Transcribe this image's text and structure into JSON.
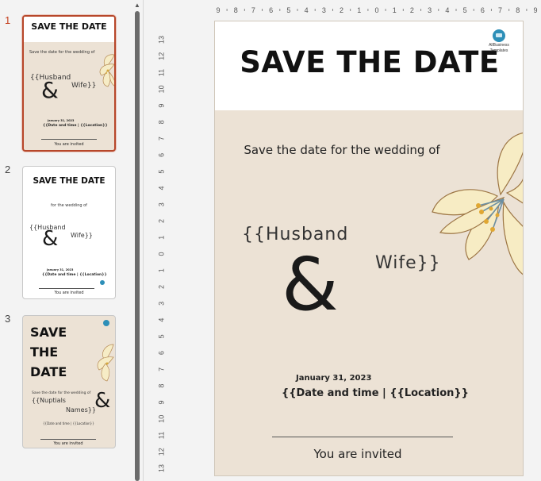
{
  "slides": [
    {
      "number": "1",
      "title": "SAVE THE DATE",
      "subtitle": "Save the date for the wedding of",
      "husband": "{{Husband",
      "amp": "&",
      "wife": "Wife}}",
      "date": "January 31, 2023",
      "datetime": "{{Date and time | {{Location}}",
      "invited": "You are invited"
    },
    {
      "number": "2",
      "title": "SAVE THE DATE",
      "subtitle": "for the wedding of",
      "husband": "{{Husband",
      "amp": "&",
      "wife": "Wife}}",
      "date": "January 31, 2023",
      "datetime": "{{Date and time | {{Location}}",
      "invited": "You are invited"
    },
    {
      "number": "3",
      "title_line1": "SAVE",
      "title_line2": "THE",
      "title_line3": "DATE",
      "subtitle": "Save the date for the wedding of",
      "nuptials": "{{Nuptials",
      "names": "Names}}",
      "amp": "&",
      "datetime": "{{Date and time | {{Location}}",
      "invited": "You are invited"
    }
  ],
  "main_slide": {
    "title": "SAVE THE DATE",
    "subtitle": "Save the date for the wedding of",
    "husband": "{{Husband",
    "amp": "&",
    "wife": "Wife}}",
    "date": "January 31, 2023",
    "datetime": "{{Date and time | {{Location}}",
    "invited": "You are invited",
    "logo_line1": "AllBusiness",
    "logo_line2": "Templates"
  },
  "rulers": {
    "horizontal": [
      "9",
      "8",
      "7",
      "6",
      "5",
      "4",
      "3",
      "2",
      "1",
      "0",
      "1",
      "2",
      "3",
      "4",
      "5",
      "6",
      "7",
      "8",
      "9"
    ],
    "vertical": [
      "13",
      "12",
      "11",
      "10",
      "9",
      "8",
      "7",
      "6",
      "5",
      "4",
      "3",
      "2",
      "1",
      "0",
      "1",
      "2",
      "3",
      "4",
      "5",
      "6",
      "7",
      "8",
      "9",
      "10",
      "11",
      "12",
      "13"
    ]
  },
  "colors": {
    "slide_background": "#ece2d5",
    "selection_accent": "#b7472a",
    "logo_blue": "#2d8fb8"
  }
}
